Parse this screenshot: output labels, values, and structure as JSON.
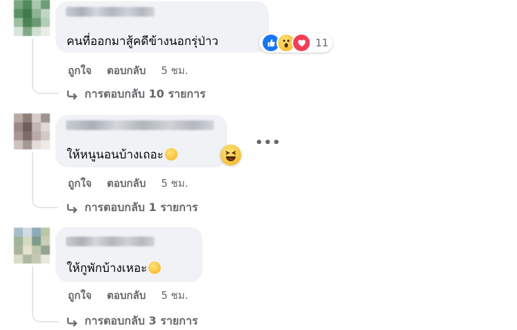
{
  "comments": [
    {
      "text": "คนที่ออกมาสู้คดีข้างนอกรุ่ป่าว",
      "reaction_icons": [
        "like-icon",
        "wow-icon",
        "love-icon"
      ],
      "reaction_count": "11",
      "actions": {
        "like": "ถูกใจ",
        "reply": "ตอบกลับ",
        "time": "5 ชม."
      },
      "replies": "การตอบกลับ 10 รายการ",
      "avatar_colors": [
        "#7aa584",
        "#4f8a5b",
        "#a9c7ad",
        "#6e9d76",
        "#5d9166",
        "#3e7a4b",
        "#8bb394",
        "#c2d6c4",
        "#9cbfa3",
        "#4a8455",
        "#6b9a73",
        "#b3ccb6",
        "#d9e5da",
        "#7fa987",
        "#cfdfd1",
        "#e6eee7"
      ]
    },
    {
      "text": "ให้หนูนอนบ้างเถอะ",
      "reaction_icons": [
        "laughing-squint-icon"
      ],
      "actions": {
        "like": "ถูกใจ",
        "reply": "ตอบกลับ",
        "time": "5 ชม."
      },
      "replies": "การตอบกลับ 1 รายการ",
      "avatar_colors": [
        "#b8a9a2",
        "#8d7d78",
        "#d6cbc6",
        "#a0938e",
        "#9a8884",
        "#6f5f5c",
        "#c4b4ae",
        "#e0d8d4",
        "#a59691",
        "#7d6c68",
        "#b9aaa5",
        "#d2c8c4",
        "#cfc3bf",
        "#a69894",
        "#e3dcd9",
        "#efeae8"
      ]
    },
    {
      "text": "ให้กูพักบ้างเหอะ",
      "actions": {
        "like": "ถูกใจ",
        "reply": "ตอบกลับ",
        "time": "5 ชม."
      },
      "replies": "การตอบกลับ 3 รายการ",
      "avatar_colors": [
        "#a7bcc9",
        "#cfdde3",
        "#8ea9b8",
        "#b9c8a8",
        "#9eb39b",
        "#d4d9c2",
        "#7e9a8a",
        "#c9cfb5",
        "#a8b59a",
        "#e4e2cf",
        "#bcc7ad",
        "#93a48f",
        "#d9dcc8",
        "#aeb8a0",
        "#c5c9b4",
        "#e8e7da"
      ]
    }
  ]
}
